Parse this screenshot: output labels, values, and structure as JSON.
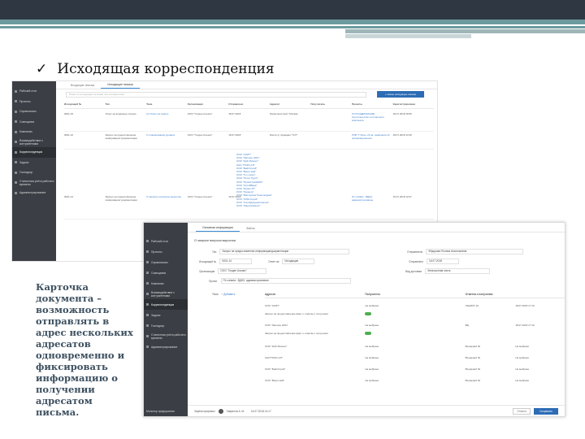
{
  "slide": {
    "title": "Исходящая корреспонденция",
    "check_icon": "✓",
    "caption": "Карточка документа – возможность отправлять в адрес нескольких адресатов одновременно и фиксировать информацию о получении адресатом письма."
  },
  "shot1": {
    "tabs": [
      "Входящие письма",
      "Исходящие письма"
    ],
    "search_placeholder": "Поиск по исходящим письмам или контрагентам",
    "new_button": "+ Новое исходящее письмо",
    "columns": [
      "Исходящий №",
      "Тип",
      "Тема",
      "Организация",
      "Отправлено",
      "Адресат",
      "Получатель",
      "Проекты",
      "Зарегистрировано"
    ],
    "rows": [
      {
        "num": "0001-15",
        "type": "Ответ на входящее письмо",
        "subject": "(1) Ответ на запрос",
        "org": "ООО \"Голден Альянс\"",
        "date": "18.07.2018",
        "addr": "Промспецстрой / Москва",
        "project": "ГО РСОДЕРЖАНИЕ - Строительство гостиничного комплекса",
        "reg": "18.07.2018 18:56"
      },
      {
        "num": "0001-16",
        "type": "Запрос на предоставление информации/ документации",
        "subject": "О планировании уровнях",
        "org": "ООО \"Голден Альянс\"",
        "date": "18.07.2018",
        "addr": "Институт Армадия \"ГНТ\"",
        "project": "ГИФ \"7 Ягры: 21 кв. заявление кб организационного",
        "reg": "18.07.2018 13:36"
      },
      {
        "num": "0001-14",
        "type": "Запрос на предоставление информации/ документации",
        "subject": "О запросе на вопрос выростки",
        "org": "ООО \"Голден Альянс\"",
        "date": "16.07.2018",
        "addr": "",
        "project": "ГК-сч/ав/м - ВДНХ, административное",
        "reg": "16.07.2018 12:07"
      }
    ],
    "addr_list": [
      "ООО \"АСИТ\"",
      "ООО \"Лапшин НОН\"",
      "ООО \"Кейт-Бизнес\"",
      "ОАО \"ПСКС-АЛ\"",
      "ООО \"БейсСтрой\"",
      "ООО \"Вагрс-мой\"",
      "ООО \"Гл-х-Ноль\"",
      "ООО \"Лотос Групп\"",
      "ООО \"ПромСтройНИИ\"",
      "ООО \"СтройВиде\"",
      "ООО \"Прово-ТК\"",
      "ООО \"Гранд-Ц\"",
      "ООО \"Мастерпак Технолоджис\"",
      "ООО \"СПМ-Строй\"",
      "ООО \"Стройдокументжилья\"",
      "ООО \"Линия-Ремонт\""
    ]
  },
  "sidebar": {
    "items": [
      "Рабочий стол",
      "Проекты",
      "Справочники",
      "Совещания",
      "Компании",
      "Взаимодействие с контрагентами",
      "Корреспонденция",
      "Задачи",
      "Госнадзор",
      "Статистика учёта рабочего времени",
      "Администрирование"
    ],
    "bottom": "Монитор предприятия"
  },
  "shot2": {
    "tabs": [
      "Основная информация",
      "Файлы"
    ],
    "header": "О запросе вопроса выростки",
    "fields": {
      "type_label": "Тип",
      "type_value": "Запрос на предоставление информации/документации",
      "out_label": "Исходящий №",
      "out_value": "0001-14",
      "reply_label": "Ответ на",
      "reply_value": "Исходящие",
      "org_label": "Организация",
      "org_value": "ООО \"Голден Альянс\"",
      "project_label": "Проект",
      "project_value": "ГК-сч/ав/м - ВДНХ, административное",
      "sender_label": "Отправитель",
      "sender_value": "Фёдорова Полина Анатольевна",
      "sent_label": "Отправлено",
      "sent_value": "16.07.2018",
      "delivery_label": "Вид доставки",
      "delivery_value": "Электронная почта",
      "topic_label": "Тема",
      "add_label": "+ Добавить"
    },
    "grid_columns": [
      "Адресат",
      "Получатель",
      "Отметка о получении"
    ],
    "grid_rows": [
      {
        "addr": "ООО \"АСИТ\"",
        "recv": "Не выбрано",
        "mark": "ПЦАИКТ-16",
        "date": "18.07.2018 17:10"
      },
      {
        "addr": "Запрос на предоставление факт о отметке о получении",
        "recv": "",
        "mark": "",
        "date": ""
      },
      {
        "addr": "ООО \"Лапшин НОН\"",
        "recv": "Не выбрано",
        "mark": "ВД",
        "date": "18.07.2018 17:10"
      },
      {
        "addr": "Запрос на предоставление факт о отметке о получении",
        "recv": "",
        "mark": "",
        "date": ""
      },
      {
        "addr": "ООО \"Кейт-Бизнес\"",
        "recv": "Не выбрано",
        "mark": "Входящий №",
        "date": "Не выбрано"
      },
      {
        "addr": "ОАО\"ПСКС-АЛ\"",
        "recv": "Не выбрано",
        "mark": "Входящий №",
        "date": "Не выбрано"
      },
      {
        "addr": "ООО \"БейсСтрой\"",
        "recv": "Не выбрано",
        "mark": "Входящий №",
        "date": "Не выбрано"
      },
      {
        "addr": "ООО \"Вагрс-мой\"",
        "recv": "Не выбрано",
        "mark": "Входящий №",
        "date": "Не выбрано"
      }
    ],
    "footer": {
      "registered_label": "Зарегистрировал",
      "registered_value": "Гаврилов А. М.",
      "registered_date": "16.07.2018 14:17",
      "cancel": "Отмена",
      "save": "Сохранить"
    }
  }
}
